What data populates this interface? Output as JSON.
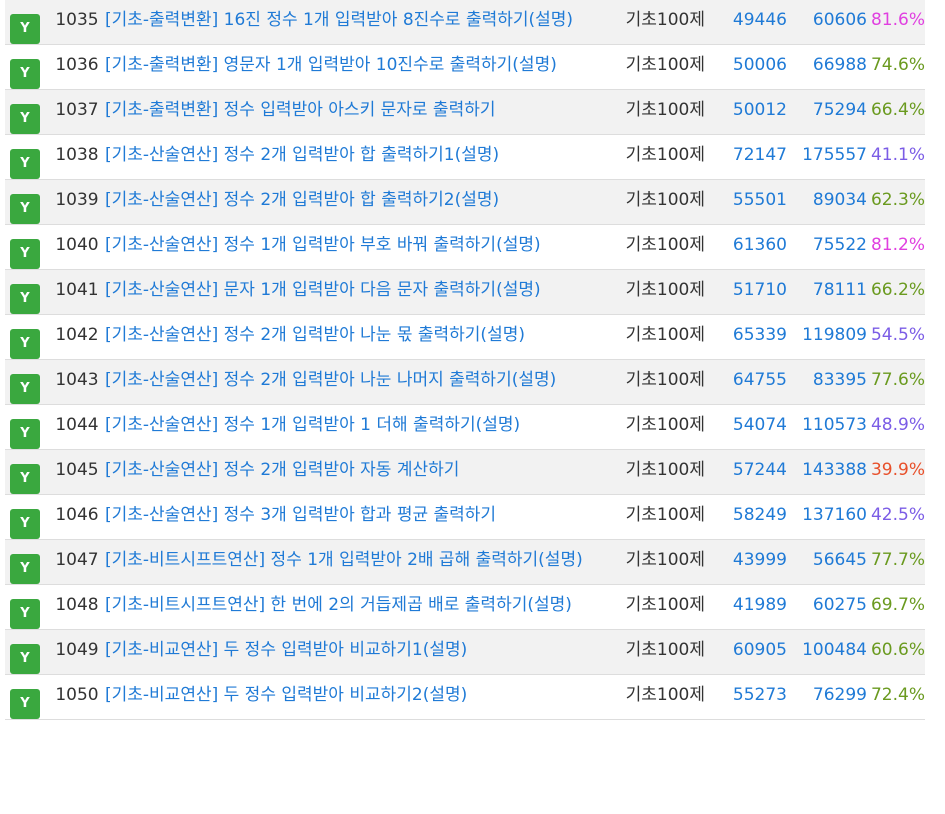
{
  "badge_label": "Y",
  "rows": [
    {
      "id": "1035",
      "title": "[기초-출력변환] 16진 정수 1개 입력받아 8진수로 출력하기(설명)",
      "category": "기초100제",
      "solved": "49446",
      "submits": "60606",
      "rate": "81.6%",
      "rate_color": "#e040e0"
    },
    {
      "id": "1036",
      "title": "[기초-출력변환] 영문자 1개 입력받아 10진수로 출력하기(설명)",
      "category": "기초100제",
      "solved": "50006",
      "submits": "66988",
      "rate": "74.6%",
      "rate_color": "#6a9a1f"
    },
    {
      "id": "1037",
      "title": "[기초-출력변환] 정수 입력받아 아스키 문자로 출력하기",
      "category": "기초100제",
      "solved": "50012",
      "submits": "75294",
      "rate": "66.4%",
      "rate_color": "#6a9a1f"
    },
    {
      "id": "1038",
      "title": "[기초-산술연산] 정수 2개 입력받아 합 출력하기1(설명)",
      "category": "기초100제",
      "solved": "72147",
      "submits": "175557",
      "rate": "41.1%",
      "rate_color": "#7b5ce6"
    },
    {
      "id": "1039",
      "title": "[기초-산술연산] 정수 2개 입력받아 합 출력하기2(설명)",
      "category": "기초100제",
      "solved": "55501",
      "submits": "89034",
      "rate": "62.3%",
      "rate_color": "#6a9a1f"
    },
    {
      "id": "1040",
      "title": "[기초-산술연산] 정수 1개 입력받아 부호 바꿔 출력하기(설명)",
      "category": "기초100제",
      "solved": "61360",
      "submits": "75522",
      "rate": "81.2%",
      "rate_color": "#e040e0"
    },
    {
      "id": "1041",
      "title": "[기초-산술연산] 문자 1개 입력받아 다음 문자 출력하기(설명)",
      "category": "기초100제",
      "solved": "51710",
      "submits": "78111",
      "rate": "66.2%",
      "rate_color": "#6a9a1f"
    },
    {
      "id": "1042",
      "title": "[기초-산술연산] 정수 2개 입력받아 나눈 몫 출력하기(설명)",
      "category": "기초100제",
      "solved": "65339",
      "submits": "119809",
      "rate": "54.5%",
      "rate_color": "#7b5ce6"
    },
    {
      "id": "1043",
      "title": "[기초-산술연산] 정수 2개 입력받아 나눈 나머지 출력하기(설명)",
      "category": "기초100제",
      "solved": "64755",
      "submits": "83395",
      "rate": "77.6%",
      "rate_color": "#6a9a1f"
    },
    {
      "id": "1044",
      "title": "[기초-산술연산] 정수 1개 입력받아 1 더해 출력하기(설명)",
      "category": "기초100제",
      "solved": "54074",
      "submits": "110573",
      "rate": "48.9%",
      "rate_color": "#7b5ce6"
    },
    {
      "id": "1045",
      "title": "[기초-산술연산] 정수 2개 입력받아 자동 계산하기",
      "category": "기초100제",
      "solved": "57244",
      "submits": "143388",
      "rate": "39.9%",
      "rate_color": "#e8502a"
    },
    {
      "id": "1046",
      "title": "[기초-산술연산] 정수 3개 입력받아 합과 평균 출력하기",
      "category": "기초100제",
      "solved": "58249",
      "submits": "137160",
      "rate": "42.5%",
      "rate_color": "#7b5ce6"
    },
    {
      "id": "1047",
      "title": "[기초-비트시프트연산] 정수 1개 입력받아 2배 곱해 출력하기(설명)",
      "category": "기초100제",
      "solved": "43999",
      "submits": "56645",
      "rate": "77.7%",
      "rate_color": "#6a9a1f"
    },
    {
      "id": "1048",
      "title": "[기초-비트시프트연산] 한 번에 2의 거듭제곱 배로 출력하기(설명)",
      "category": "기초100제",
      "solved": "41989",
      "submits": "60275",
      "rate": "69.7%",
      "rate_color": "#6a9a1f"
    },
    {
      "id": "1049",
      "title": "[기초-비교연산] 두 정수 입력받아 비교하기1(설명)",
      "category": "기초100제",
      "solved": "60905",
      "submits": "100484",
      "rate": "60.6%",
      "rate_color": "#6a9a1f"
    },
    {
      "id": "1050",
      "title": "[기초-비교연산] 두 정수 입력받아 비교하기2(설명)",
      "category": "기초100제",
      "solved": "55273",
      "submits": "76299",
      "rate": "72.4%",
      "rate_color": "#6a9a1f"
    }
  ]
}
